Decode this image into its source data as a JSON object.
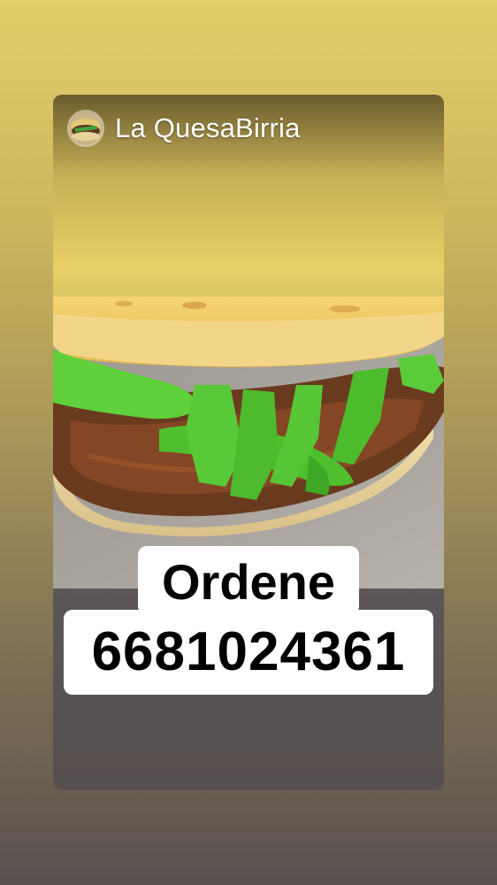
{
  "story": {
    "account_name": "La QuesaBirria",
    "cta": {
      "line1": "Ordene",
      "line2": "6681024361"
    }
  },
  "icons": {
    "avatar": "profile-avatar-taco"
  },
  "colors": {
    "background_top": "#e3cd6a",
    "background_bottom": "#5a5150",
    "text_primary": "#ffffff",
    "cta_text": "#000000",
    "cta_background": "#ffffff"
  }
}
